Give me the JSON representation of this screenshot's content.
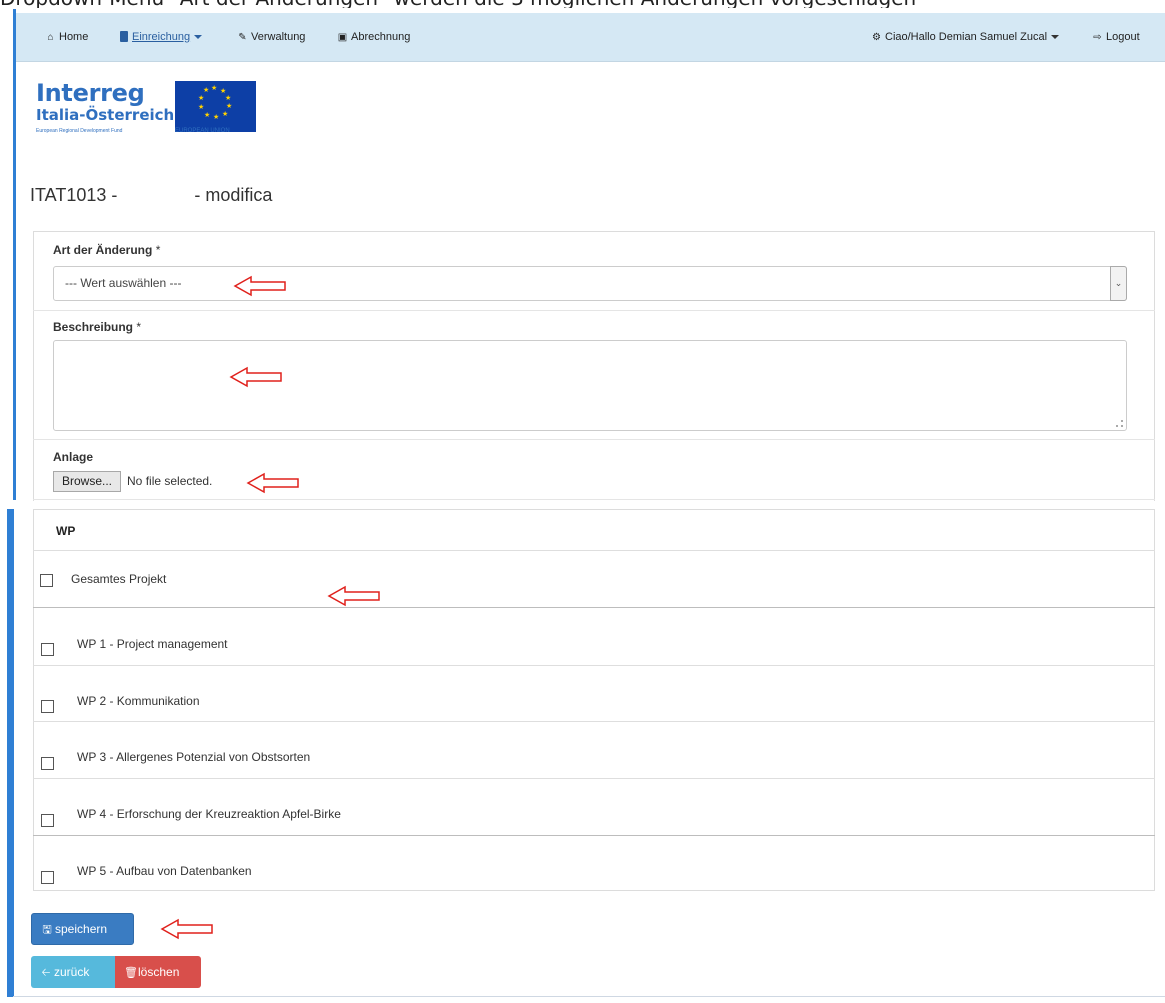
{
  "caption": "Dropdown-Menü \"Art der Änderungen\" werden die 3 möglichen Änderungen vorgeschlagen",
  "navbar": {
    "items": [
      {
        "label": "Home",
        "icon": "home-icon"
      },
      {
        "label": "Einreichung",
        "icon": "book-icon",
        "active": true
      },
      {
        "label": "Verwaltung",
        "icon": "pencil-icon"
      },
      {
        "label": "Abrechnung",
        "icon": "banknote-icon"
      }
    ],
    "user": {
      "label": "Ciao/Hallo Demian Samuel Zucal",
      "icon": "gear-icon"
    },
    "logout": {
      "label": "Logout",
      "icon": "logout-icon"
    }
  },
  "logo": {
    "wordmark": "Interreg",
    "subtitle": "Italia-Österreich",
    "fund": "European Regional Development Fund",
    "eu": "EUROPEAN UNION"
  },
  "page": {
    "code": "ITAT1013 -",
    "suffix": "- modifica"
  },
  "form": {
    "type_label": "Art der Änderung",
    "type_required": "*",
    "type_value": "--- Wert auswählen ---",
    "description_label": "Beschreibung",
    "description_required": "*",
    "description_value": "",
    "attachment_label": "Anlage",
    "browse_label": "Browse...",
    "file_status": "No file selected."
  },
  "wp": {
    "header": "WP",
    "whole_project": "Gesamtes Projekt",
    "items": [
      "WP 1 - Project management",
      "WP 2 - Kommunikation",
      "WP 3 - Allergenes Potenzial von Obstsorten",
      "WP 4 - Erforschung der Kreuzreaktion Apfel-Birke",
      "WP 5 - Aufbau von Datenbanken"
    ]
  },
  "buttons": {
    "save": "speichern",
    "back": "zurück",
    "delete": "löschen"
  },
  "colors": {
    "navbar": "#d5e8f4",
    "accent": "#2f7fd4",
    "primary": "#3a7cc2",
    "info": "#56b9dc",
    "danger": "#d84f4b",
    "annotation_arrow": "#e0201b"
  }
}
